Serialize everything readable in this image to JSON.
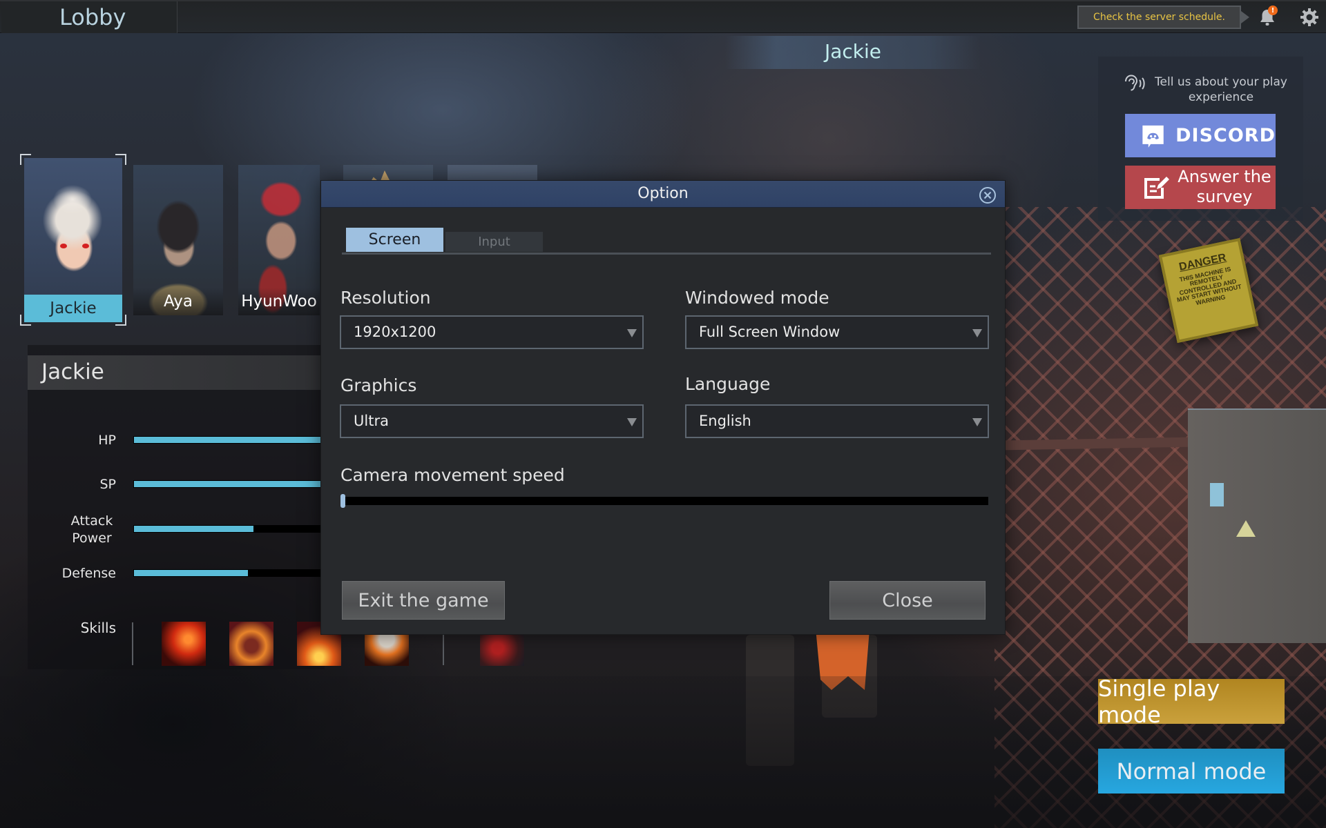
{
  "topbar": {
    "title": "Lobby",
    "server_notice": "Check the server schedule.",
    "notification_badge": "!",
    "icons": [
      "bell-icon",
      "gear-icon"
    ]
  },
  "selected_character": {
    "banner_name": "Jackie"
  },
  "feedback": {
    "message": "Tell us about your play experience",
    "discord_label": "DISCORD",
    "survey_label": "Answer the survey",
    "colors": {
      "discord": "#7289da",
      "survey": "#b5474c"
    }
  },
  "characters": [
    {
      "name": "Jackie",
      "selected": true
    },
    {
      "name": "Aya",
      "selected": false
    },
    {
      "name": "HyunWoo",
      "selected": false
    }
  ],
  "stats": {
    "title": "Jackie",
    "items": [
      {
        "label": "HP",
        "value": 1.0
      },
      {
        "label": "SP",
        "value": 1.0
      },
      {
        "label": "Attack Power",
        "value": 0.63
      },
      {
        "label": "Defense",
        "value": 0.6
      }
    ],
    "skills_label": "Skills",
    "skills": [
      "skill-q",
      "skill-w",
      "skill-e",
      "skill-r",
      "skill-weapon"
    ],
    "bar_color": "#5bbcd8"
  },
  "modes": {
    "single": "Single play mode",
    "normal": "Normal mode"
  },
  "dialog": {
    "title": "Option",
    "tabs": [
      {
        "label": "Screen",
        "active": true
      },
      {
        "label": "Input",
        "active": false
      }
    ],
    "fields": {
      "resolution": {
        "label": "Resolution",
        "value": "1920x1200"
      },
      "windowed_mode": {
        "label": "Windowed mode",
        "value": "Full Screen Window"
      },
      "graphics": {
        "label": "Graphics",
        "value": "Ultra"
      },
      "language": {
        "label": "Language",
        "value": "English"
      }
    },
    "camera_speed": {
      "label": "Camera movement speed",
      "value": 0.0
    },
    "exit_label": "Exit the game",
    "close_label": "Close"
  }
}
